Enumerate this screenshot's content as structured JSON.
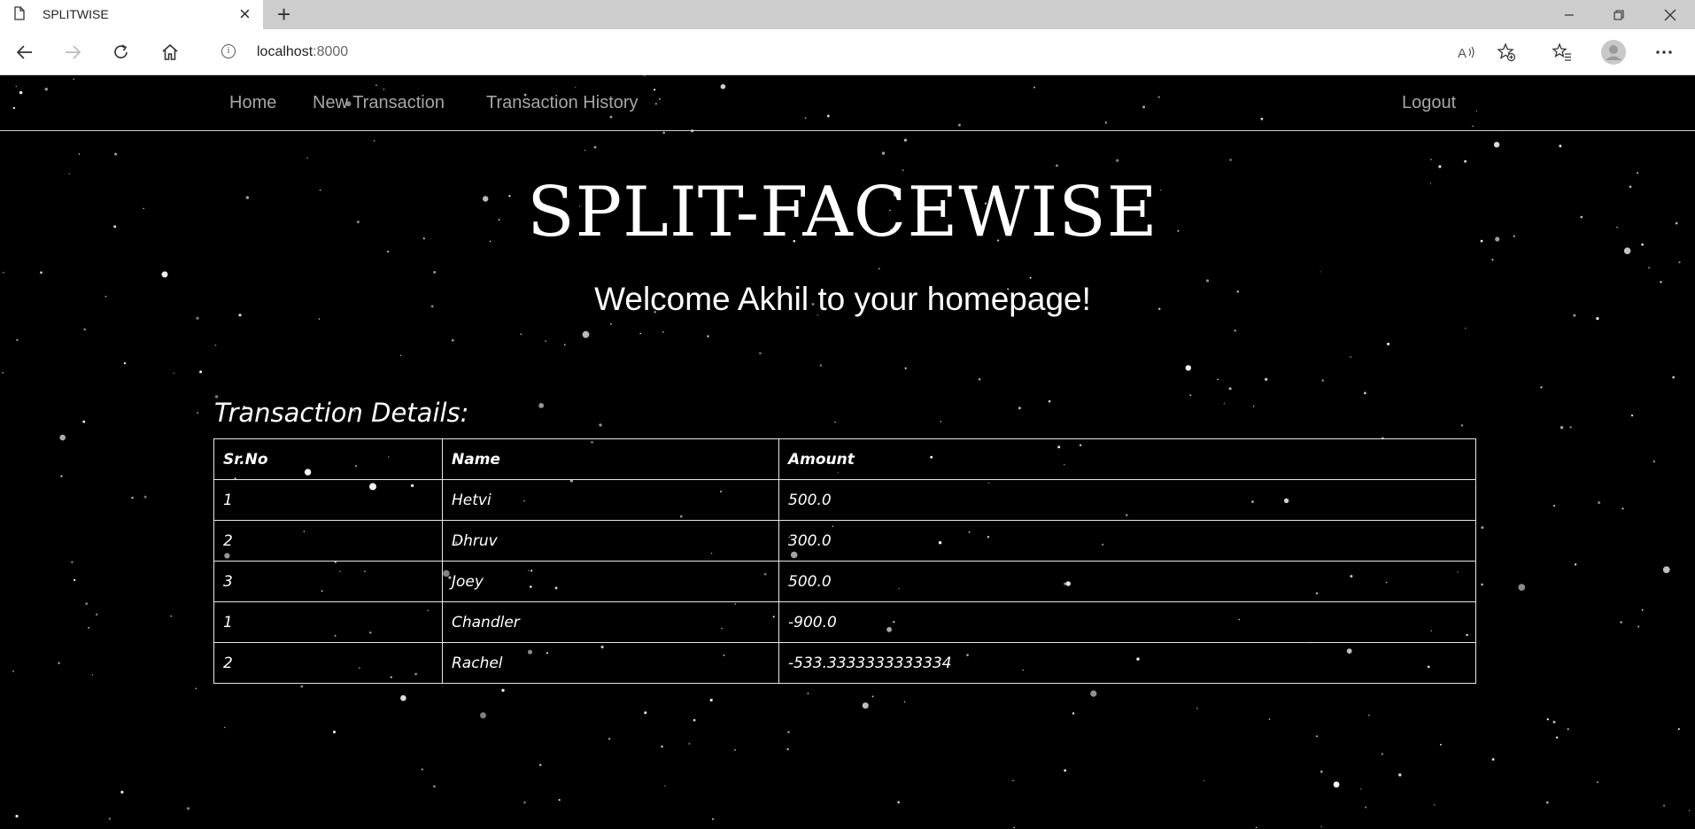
{
  "browser": {
    "tab_title": "SPLITWISE",
    "url_host": "localhost",
    "url_port": ":8000"
  },
  "nav": {
    "home": "Home",
    "new_transaction": "New Transaction",
    "history": "Transaction History",
    "logout": "Logout"
  },
  "hero": {
    "title": "SPLIT-FACEWISE",
    "welcome": "Welcome Akhil to your homepage!"
  },
  "transactions": {
    "heading": "Transaction Details:",
    "columns": [
      "Sr.No",
      "Name",
      "Amount"
    ],
    "rows": [
      [
        "1",
        "Hetvi",
        "500.0"
      ],
      [
        "2",
        "Dhruv",
        "300.0"
      ],
      [
        "3",
        "Joey",
        "500.0"
      ],
      [
        "1",
        "Chandler",
        "-900.0"
      ],
      [
        "2",
        "Rachel",
        "-533.3333333333334"
      ]
    ]
  }
}
